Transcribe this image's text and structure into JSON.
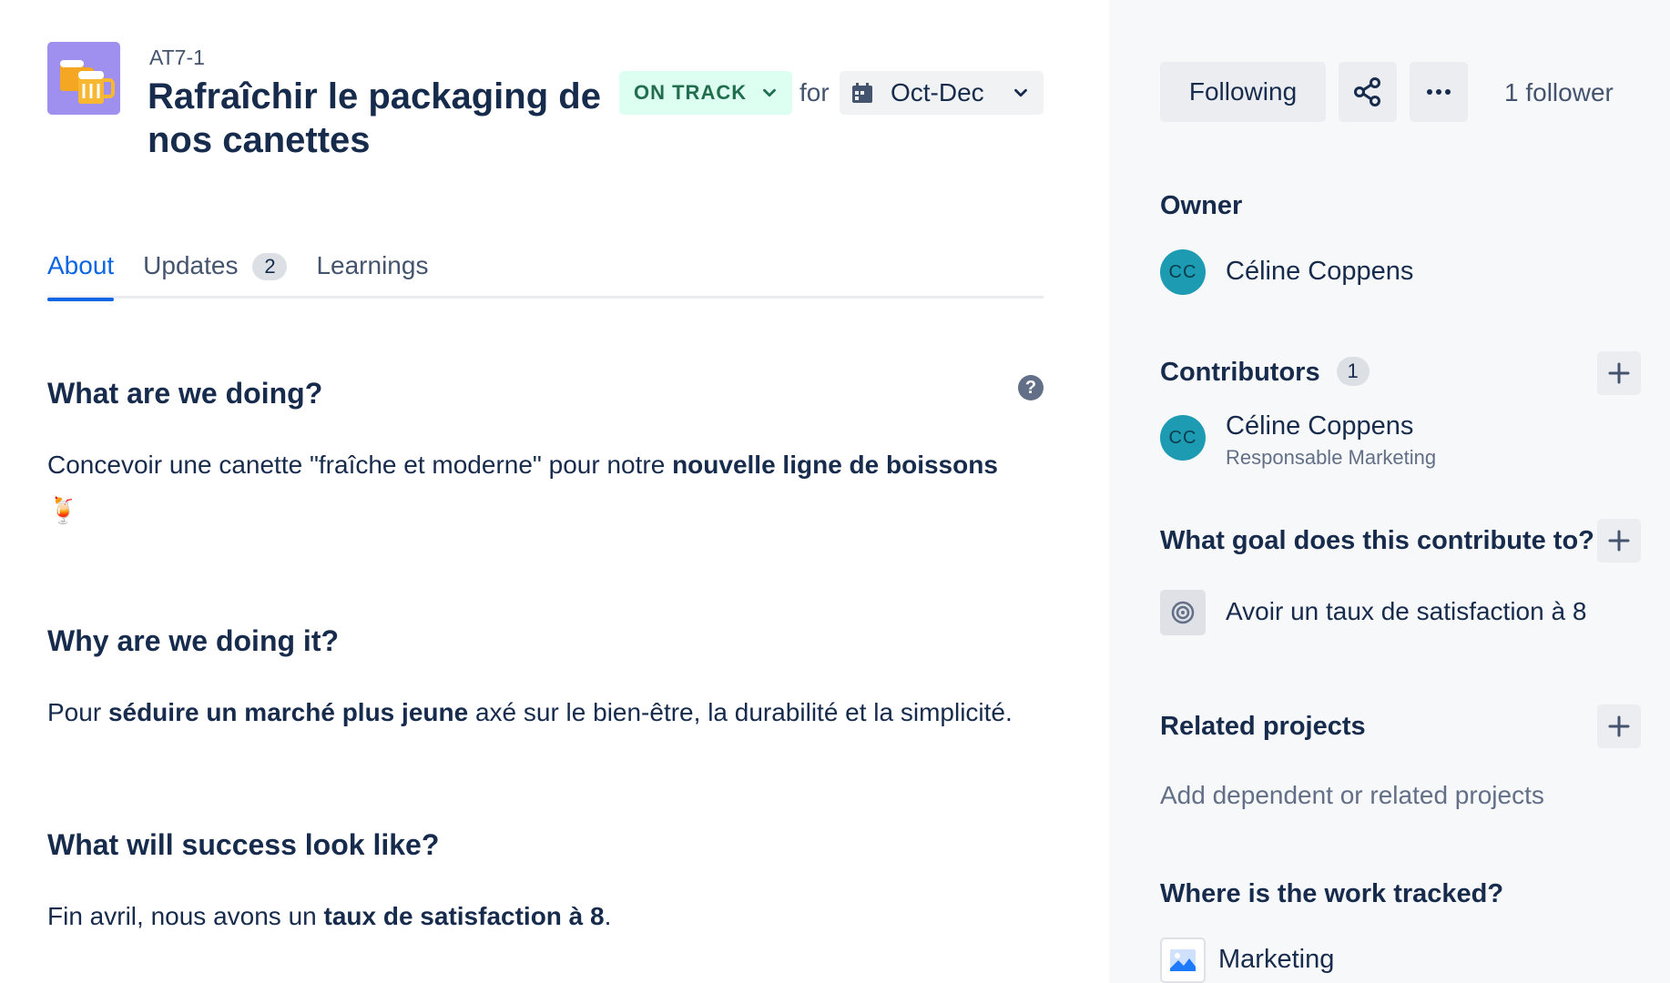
{
  "project": {
    "key": "AT7-1",
    "title": "Rafraîchir le packaging de nos canettes",
    "status": "ON TRACK",
    "status_color": "#216e4e",
    "for_label": "for",
    "target_date": "Oct-Dec",
    "icon": "beer-mugs-icon"
  },
  "tabs": [
    {
      "label": "About",
      "active": true
    },
    {
      "label": "Updates",
      "count": "2"
    },
    {
      "label": "Learnings"
    }
  ],
  "about": {
    "what": {
      "heading": "What are we doing?",
      "text_before": "Concevoir une canette \"fraîche et moderne\" pour notre ",
      "text_bold": "nouvelle ligne de boissons",
      "emoji": "🍹"
    },
    "why": {
      "heading": "Why are we doing it?",
      "text_before": "Pour ",
      "text_bold": "séduire un marché plus jeune",
      "text_after": " axé sur le bien-être, la durabilité et la simplicité."
    },
    "success": {
      "heading": "What will success look like?",
      "text_before": "Fin avril, nous avons un ",
      "text_bold": "taux de satisfaction à 8",
      "text_after": "."
    }
  },
  "side": {
    "following_label": "Following",
    "follower_count": "1 follower",
    "owner": {
      "heading": "Owner",
      "initials": "CC",
      "name": "Céline Coppens"
    },
    "contributors": {
      "heading": "Contributors",
      "count": "1",
      "items": [
        {
          "initials": "CC",
          "name": "Céline Coppens",
          "role": "Responsable Marketing"
        }
      ]
    },
    "goal": {
      "heading": "What goal does this contribute to?",
      "item": "Avoir un taux de satisfaction à 8"
    },
    "related": {
      "heading": "Related projects",
      "placeholder": "Add dependent or related projects"
    },
    "tracking": {
      "heading": "Where is the work tracked?",
      "item": "Marketing"
    }
  }
}
